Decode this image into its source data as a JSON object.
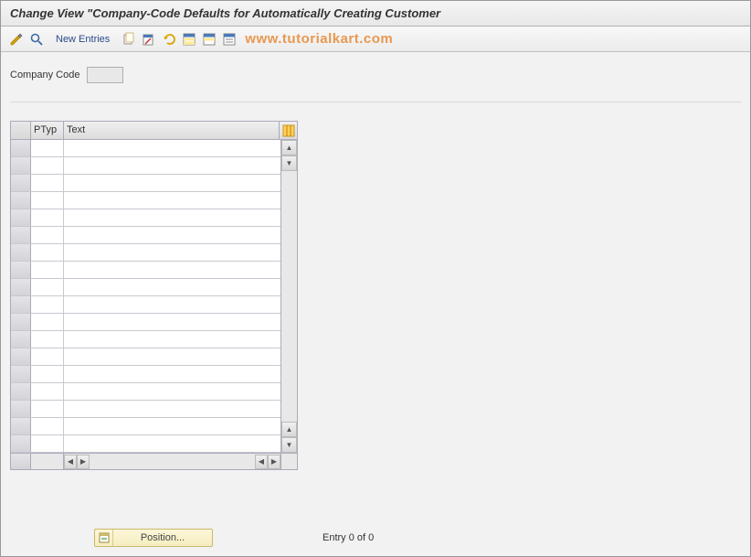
{
  "title": "Change View \"Company-Code Defaults for Automatically Creating Customer",
  "toolbar": {
    "new_entries_label": "New Entries",
    "watermark": "www.tutorialkart.com"
  },
  "company_code": {
    "label": "Company Code",
    "value": ""
  },
  "table": {
    "columns": {
      "ptyp": "PTyp",
      "text": "Text"
    },
    "rows": [
      {
        "ptyp": "",
        "text": ""
      },
      {
        "ptyp": "",
        "text": ""
      },
      {
        "ptyp": "",
        "text": ""
      },
      {
        "ptyp": "",
        "text": ""
      },
      {
        "ptyp": "",
        "text": ""
      },
      {
        "ptyp": "",
        "text": ""
      },
      {
        "ptyp": "",
        "text": ""
      },
      {
        "ptyp": "",
        "text": ""
      },
      {
        "ptyp": "",
        "text": ""
      },
      {
        "ptyp": "",
        "text": ""
      },
      {
        "ptyp": "",
        "text": ""
      },
      {
        "ptyp": "",
        "text": ""
      },
      {
        "ptyp": "",
        "text": ""
      },
      {
        "ptyp": "",
        "text": ""
      },
      {
        "ptyp": "",
        "text": ""
      },
      {
        "ptyp": "",
        "text": ""
      },
      {
        "ptyp": "",
        "text": ""
      },
      {
        "ptyp": "",
        "text": ""
      }
    ]
  },
  "footer": {
    "position_label": "Position...",
    "entry_counter": "Entry 0 of 0"
  }
}
